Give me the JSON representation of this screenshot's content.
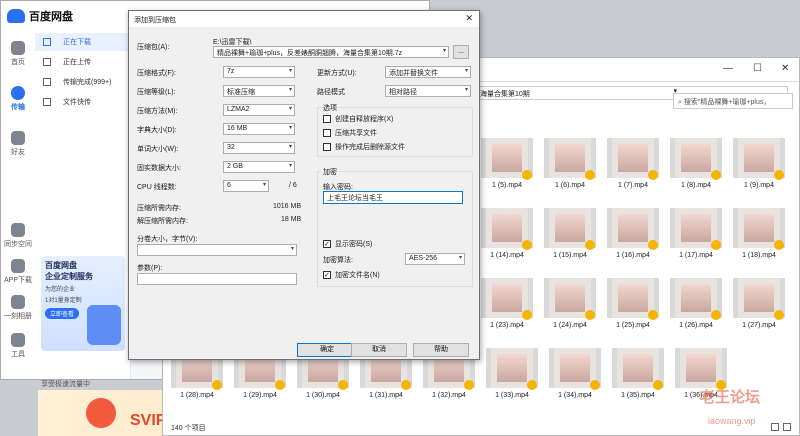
{
  "baidu": {
    "app_name": "百度网盘",
    "rail": [
      {
        "label": "首页"
      },
      {
        "label": "传输"
      },
      {
        "label": "好友"
      },
      {
        "label": "同步空间"
      },
      {
        "label": "APP下载"
      },
      {
        "label": "一刻相册"
      },
      {
        "label": "工具"
      }
    ],
    "side": [
      {
        "label": "正在下载"
      },
      {
        "label": "正在上传"
      },
      {
        "label": "传输完成(999+)"
      },
      {
        "label": "文件快传"
      }
    ],
    "promo": {
      "title": "百度网盘",
      "subtitle": "企业定制服务",
      "line1": "为您的企业",
      "line2": "1对1量身定制",
      "button": "立即查看"
    },
    "accel": "享受极速流量中",
    "svip": "SVIP直"
  },
  "explorer": {
    "address": "，海量合集第10期",
    "search_placeholder": "搜索\"精品裸舞+瑜珈+plus，",
    "status": "140 个项目",
    "rows": [
      [
        "1 (5).mp4",
        "1 (6).mp4",
        "1 (7).mp4",
        "1 (8).mp4",
        "1 (9).mp4"
      ],
      [
        "1 (14).mp4",
        "1 (15).mp4",
        "1 (16).mp4",
        "1 (17).mp4",
        "1 (18).mp4"
      ],
      [
        "1 (23).mp4",
        "1 (24).mp4",
        "1 (25).mp4",
        "1 (26).mp4",
        "1 (27).mp4"
      ],
      [
        "1 (28).mp4",
        "1 (29).mp4",
        "1 (30).mp4",
        "1 (31).mp4",
        "1 (32).mp4",
        "1 (33).mp4",
        "1 (34).mp4",
        "1 (35).mp4",
        "1 (36).mp4"
      ]
    ]
  },
  "dialog": {
    "title": "添加到压缩包",
    "archive_label": "压缩包(A):",
    "archive_path": "E:\\迅雷下载\\",
    "archive_name": "精品裸舞+瑜珈+plus，反差婊酮胴翘腾，海量合集第10期.7z",
    "browse": "...",
    "format_label": "压缩格式(F):",
    "format_value": "7z",
    "level_label": "压缩等级(L):",
    "level_value": "标准压缩",
    "method_label": "压缩方法(M):",
    "method_value": "LZMA2",
    "dict_label": "字典大小(D):",
    "dict_value": "16 MB",
    "word_label": "单词大小(W):",
    "word_value": "32",
    "solid_label": "固实数据大小:",
    "solid_value": "2 GB",
    "cpu_label": "CPU 线程数:",
    "cpu_value": "6",
    "cpu_total": "/ 6",
    "mem_comp_label": "压缩所需内存:",
    "mem_comp_value": "1016 MB",
    "mem_decomp_label": "解压缩所需内存:",
    "mem_decomp_value": "18 MB",
    "split_label": "分卷大小，字节(V):",
    "params_label": "参数(P):",
    "update_label": "更新方式(U):",
    "update_value": "添加并替换文件",
    "path_label": "路径模式",
    "path_value": "相对路径",
    "options_title": "选项",
    "opt_sfx": "创建自释放程序(X)",
    "opt_shared": "压缩共享文件",
    "opt_delete": "操作完成后删除源文件",
    "encrypt_title": "加密",
    "password_label": "输入密码:",
    "password_value": "上毛王论坛当毛王",
    "show_password": "显示密码(S)",
    "enc_method_label": "加密算法:",
    "enc_method_value": "AES-256",
    "encrypt_names": "加密文件名(N)",
    "ok": "确定",
    "cancel": "取消",
    "help": "帮助"
  },
  "watermark": {
    "line1": "老王论坛",
    "line2": "laowang.vip"
  }
}
